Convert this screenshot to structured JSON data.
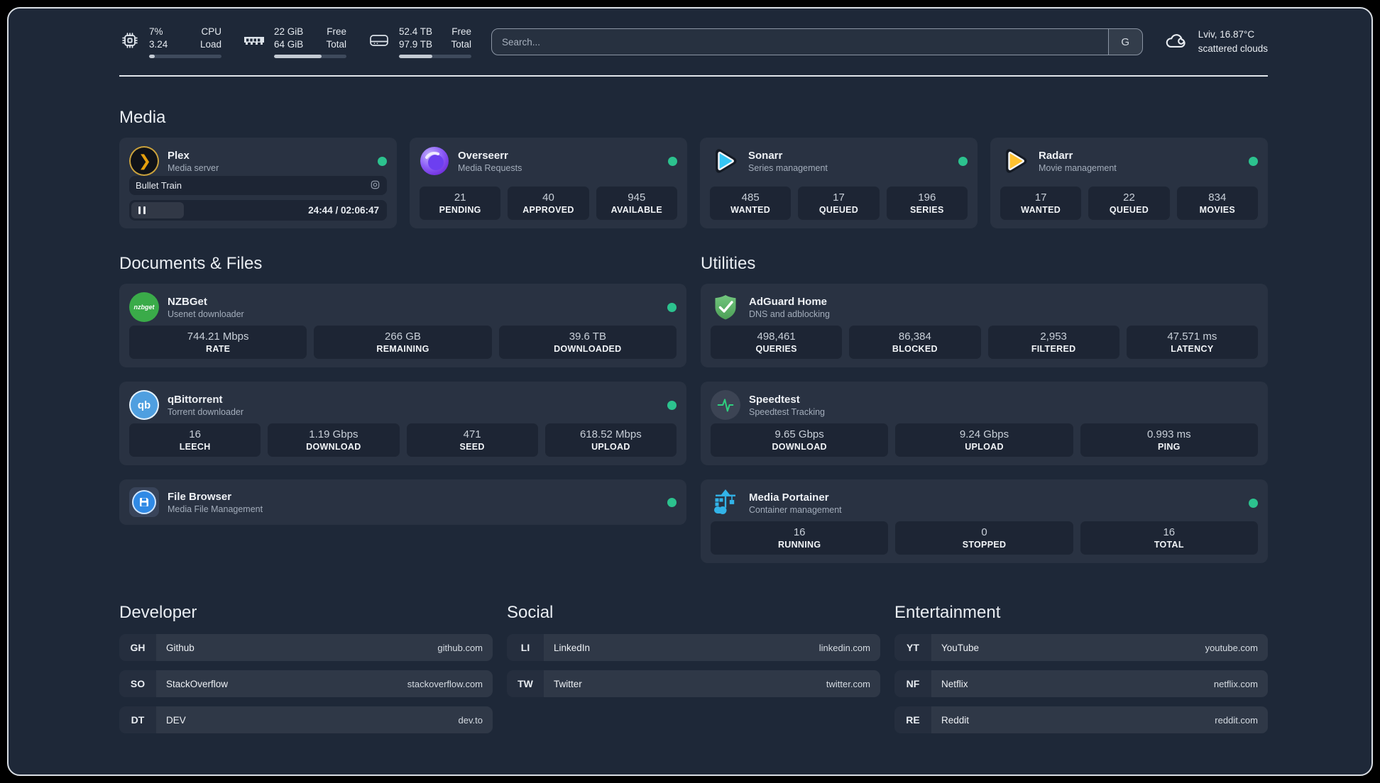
{
  "header": {
    "cpu": {
      "value_top": "7%",
      "value_bottom": "3.24",
      "label_top": "CPU",
      "label_bottom": "Load",
      "progress": "8%"
    },
    "memory": {
      "value_top": "22 GiB",
      "value_bottom": "64 GiB",
      "label_top": "Free",
      "label_bottom": "Total",
      "progress": "66%"
    },
    "disk": {
      "value_top": "52.4 TB",
      "value_bottom": "97.9 TB",
      "label_top": "Free",
      "label_bottom": "Total",
      "progress": "46%"
    },
    "search": {
      "placeholder": "Search...",
      "provider_label": "G"
    },
    "weather": {
      "location": "Lviv, 16.87°C",
      "condition": "scattered clouds"
    }
  },
  "sections": {
    "media": {
      "title": "Media",
      "plex": {
        "name": "Plex",
        "description": "Media server",
        "status": "online",
        "now_playing": {
          "title": "Bullet Train",
          "time": "24:44 / 02:06:47"
        }
      },
      "overseerr": {
        "name": "Overseerr",
        "description": "Media Requests",
        "status": "online",
        "stats": [
          {
            "value": "21",
            "label": "PENDING"
          },
          {
            "value": "40",
            "label": "APPROVED"
          },
          {
            "value": "945",
            "label": "AVAILABLE"
          }
        ]
      },
      "sonarr": {
        "name": "Sonarr",
        "description": "Series management",
        "status": "online",
        "stats": [
          {
            "value": "485",
            "label": "WANTED"
          },
          {
            "value": "17",
            "label": "QUEUED"
          },
          {
            "value": "196",
            "label": "SERIES"
          }
        ]
      },
      "radarr": {
        "name": "Radarr",
        "description": "Movie management",
        "status": "online",
        "stats": [
          {
            "value": "17",
            "label": "WANTED"
          },
          {
            "value": "22",
            "label": "QUEUED"
          },
          {
            "value": "834",
            "label": "MOVIES"
          }
        ]
      }
    },
    "documents": {
      "title": "Documents & Files",
      "nzbget": {
        "name": "NZBGet",
        "description": "Usenet downloader",
        "status": "online",
        "logo_text": "nzbget",
        "stats": [
          {
            "value": "744.21 Mbps",
            "label": "RATE"
          },
          {
            "value": "266 GB",
            "label": "REMAINING"
          },
          {
            "value": "39.6 TB",
            "label": "DOWNLOADED"
          }
        ]
      },
      "qbittorrent": {
        "name": "qBittorrent",
        "description": "Torrent downloader",
        "status": "online",
        "logo_text": "qb",
        "stats": [
          {
            "value": "16",
            "label": "LEECH"
          },
          {
            "value": "1.19 Gbps",
            "label": "DOWNLOAD"
          },
          {
            "value": "471",
            "label": "SEED"
          },
          {
            "value": "618.52 Mbps",
            "label": "UPLOAD"
          }
        ]
      },
      "filebrowser": {
        "name": "File Browser",
        "description": "Media File Management",
        "status": "online"
      }
    },
    "utilities": {
      "title": "Utilities",
      "adguard": {
        "name": "AdGuard Home",
        "description": "DNS and adblocking",
        "stats": [
          {
            "value": "498,461",
            "label": "QUERIES"
          },
          {
            "value": "86,384",
            "label": "BLOCKED"
          },
          {
            "value": "2,953",
            "label": "FILTERED"
          },
          {
            "value": "47.571 ms",
            "label": "LATENCY"
          }
        ]
      },
      "speedtest": {
        "name": "Speedtest",
        "description": "Speedtest Tracking",
        "stats": [
          {
            "value": "9.65 Gbps",
            "label": "DOWNLOAD"
          },
          {
            "value": "9.24 Gbps",
            "label": "UPLOAD"
          },
          {
            "value": "0.993 ms",
            "label": "PING"
          }
        ]
      },
      "portainer": {
        "name": "Media Portainer",
        "description": "Container management",
        "status": "online",
        "stats": [
          {
            "value": "16",
            "label": "RUNNING"
          },
          {
            "value": "0",
            "label": "STOPPED"
          },
          {
            "value": "16",
            "label": "TOTAL"
          }
        ]
      }
    },
    "bookmarks": {
      "developer": {
        "title": "Developer",
        "links": [
          {
            "abbr": "GH",
            "name": "Github",
            "url": "github.com"
          },
          {
            "abbr": "SO",
            "name": "StackOverflow",
            "url": "stackoverflow.com"
          },
          {
            "abbr": "DT",
            "name": "DEV",
            "url": "dev.to"
          }
        ]
      },
      "social": {
        "title": "Social",
        "links": [
          {
            "abbr": "LI",
            "name": "LinkedIn",
            "url": "linkedin.com"
          },
          {
            "abbr": "TW",
            "name": "Twitter",
            "url": "twitter.com"
          }
        ]
      },
      "entertainment": {
        "title": "Entertainment",
        "links": [
          {
            "abbr": "YT",
            "name": "YouTube",
            "url": "youtube.com"
          },
          {
            "abbr": "NF",
            "name": "Netflix",
            "url": "netflix.com"
          },
          {
            "abbr": "RE",
            "name": "Reddit",
            "url": "reddit.com"
          }
        ]
      }
    }
  },
  "colors": {
    "status_online": "#2cc28e",
    "accent_plex": "#e5a00d",
    "accent_sonarr": "#35c5f4",
    "accent_radarr": "#ffc230",
    "accent_nzbget": "#3aab49",
    "accent_qbittorrent": "#4f9fe0",
    "accent_adguard": "#5fb46e",
    "accent_speedtest_line": "#2fd07f",
    "accent_portainer": "#32b3e8",
    "accent_filebrowser": "#2f89e5"
  }
}
